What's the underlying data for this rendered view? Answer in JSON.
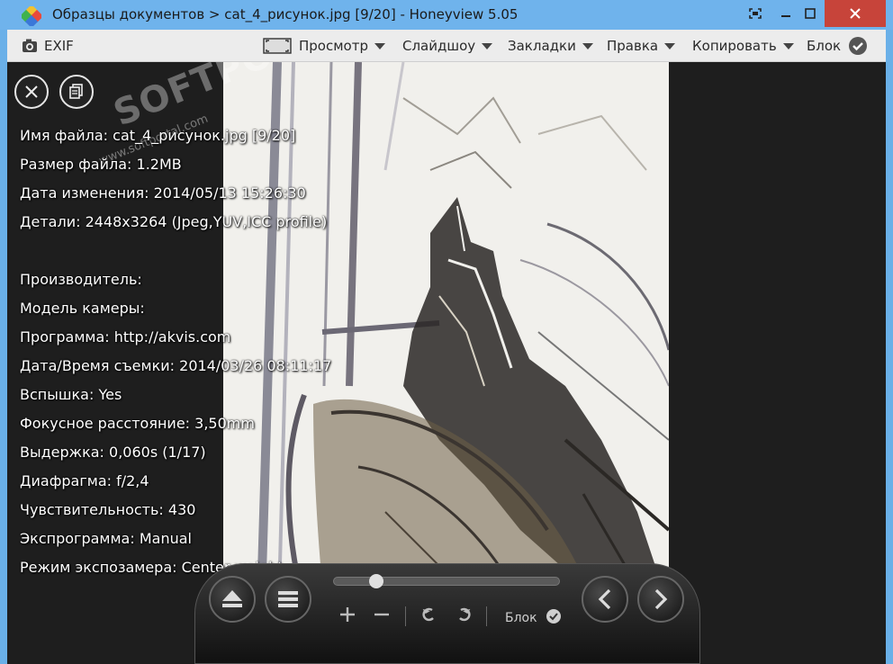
{
  "window": {
    "title": "Образцы документов > cat_4_рисунок.jpg [9/20] - Honeyview 5.05"
  },
  "menu": {
    "exif": "EXIF",
    "view": "Просмотр",
    "slideshow": "Слайдшоу",
    "bookmarks": "Закладки",
    "edit": "Правка",
    "copy": "Копировать",
    "lock": "Блок"
  },
  "info": [
    "Имя файла: cat_4_рисунок.jpg [9/20]",
    "Размер файла: 1.2MB",
    "Дата изменения: 2014/05/13 15:26:30",
    "Детали: 2448x3264 (Jpeg,YUV,ICC profile)",
    "",
    "Производитель:",
    "Модель камеры:",
    "Программа: http://akvis.com",
    "Дата/Время съемки: 2014/03/26 08:11:17",
    "Вспышка: Yes",
    "Фокусное расстояние: 3,50mm",
    "Выдержка: 0,060s (1/17)",
    "Диафрагма: f/2,4",
    "Чувствительность: 430",
    "Экспрограмма: Manual",
    "Режим экспозамера: Center weight"
  ],
  "watermark": {
    "text": "SOFTPORTAL",
    "url": "www.softportal.com"
  },
  "controls": {
    "lock": "Блок"
  },
  "colors": {
    "titlebar": "#6fb3ec",
    "close": "#c7443a",
    "menubar": "#ececec",
    "viewer_bg": "#1e1e1e"
  }
}
